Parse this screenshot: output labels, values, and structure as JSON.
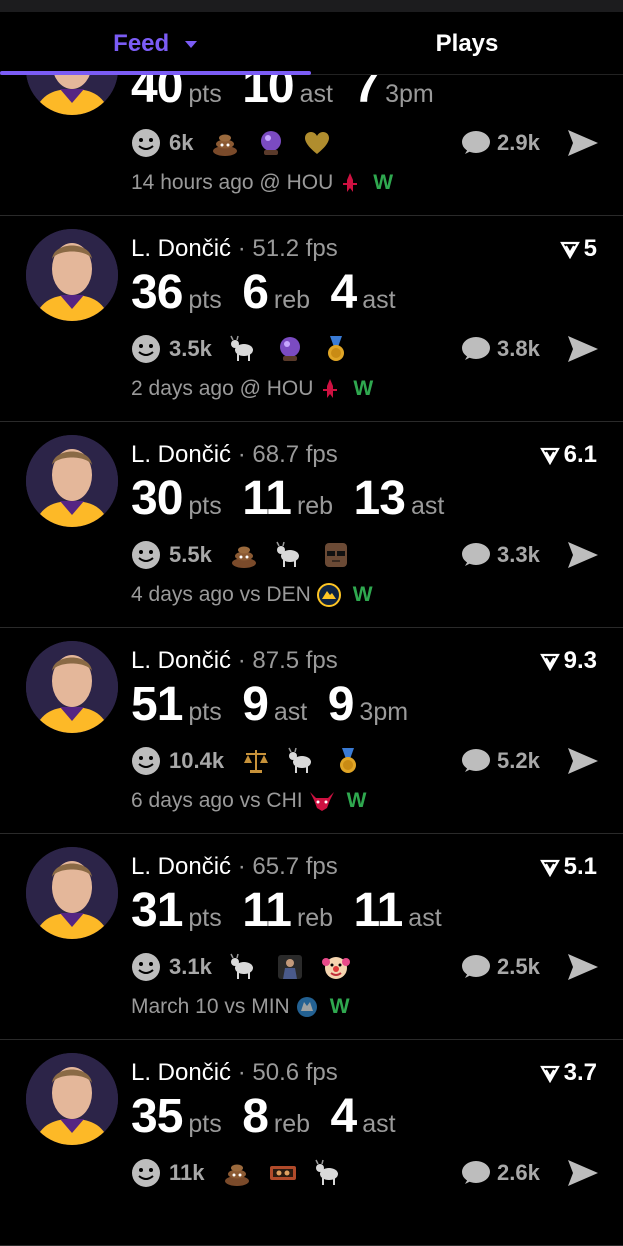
{
  "tabs": {
    "feed": "Feed",
    "plays": "Plays"
  },
  "cards": [
    {
      "player": "",
      "fps": "",
      "rank": "",
      "stats": [
        {
          "value": "40",
          "unit": "pts"
        },
        {
          "value": "10",
          "unit": "ast"
        },
        {
          "value": "7",
          "unit": "3pm"
        }
      ],
      "reaction_count": "6k",
      "emojis": [
        "poop-emoji",
        "crystal-ball-emoji",
        "gold-heart-emoji"
      ],
      "comment_count": "2.9k",
      "time": "14 hours ago @ HOU",
      "opponent_logo": "rockets-logo",
      "result": "W"
    },
    {
      "player": "L. Dončić",
      "fps": "· 51.2 fps",
      "rank": "5",
      "stats": [
        {
          "value": "36",
          "unit": "pts"
        },
        {
          "value": "6",
          "unit": "reb"
        },
        {
          "value": "4",
          "unit": "ast"
        }
      ],
      "reaction_count": "3.5k",
      "emojis": [
        "goat-emoji",
        "crystal-ball-emoji",
        "gold-medal-emoji"
      ],
      "comment_count": "3.8k",
      "time": "2 days ago @ HOU",
      "opponent_logo": "rockets-logo",
      "result": "W"
    },
    {
      "player": "L. Dončić",
      "fps": "· 68.7 fps",
      "rank": "6.1",
      "stats": [
        {
          "value": "30",
          "unit": "pts"
        },
        {
          "value": "11",
          "unit": "reb"
        },
        {
          "value": "13",
          "unit": "ast"
        }
      ],
      "reaction_count": "5.5k",
      "emojis": [
        "poop-emoji",
        "goat-emoji",
        "sunglasses-man-emoji"
      ],
      "comment_count": "3.3k",
      "time": "4 days ago vs DEN",
      "opponent_logo": "nuggets-logo",
      "result": "W"
    },
    {
      "player": "L. Dončić",
      "fps": "· 87.5 fps",
      "rank": "9.3",
      "stats": [
        {
          "value": "51",
          "unit": "pts"
        },
        {
          "value": "9",
          "unit": "ast"
        },
        {
          "value": "9",
          "unit": "3pm"
        }
      ],
      "reaction_count": "10.4k",
      "emojis": [
        "scales-emoji",
        "goat-emoji",
        "gold-medal-emoji"
      ],
      "comment_count": "5.2k",
      "time": "6 days ago vs CHI",
      "opponent_logo": "bulls-logo",
      "result": "W"
    },
    {
      "player": "L. Dončić",
      "fps": "· 65.7 fps",
      "rank": "5.1",
      "stats": [
        {
          "value": "31",
          "unit": "pts"
        },
        {
          "value": "11",
          "unit": "reb"
        },
        {
          "value": "11",
          "unit": "ast"
        }
      ],
      "reaction_count": "3.1k",
      "emojis": [
        "goat-emoji",
        "player-photo-emoji",
        "clown-emoji"
      ],
      "comment_count": "2.5k",
      "time": "March 10 vs MIN",
      "opponent_logo": "timberwolves-logo",
      "result": "W"
    },
    {
      "player": "L. Dončić",
      "fps": "· 50.6 fps",
      "rank": "3.7",
      "stats": [
        {
          "value": "35",
          "unit": "pts"
        },
        {
          "value": "8",
          "unit": "reb"
        },
        {
          "value": "4",
          "unit": "ast"
        }
      ],
      "reaction_count": "11k",
      "emojis": [
        "poop-emoji",
        "sticker-emoji",
        "goat-emoji"
      ],
      "comment_count": "2.6k",
      "time": "",
      "opponent_logo": "",
      "result": ""
    }
  ],
  "colors": {
    "accent": "#7b5cf5",
    "win": "#2fa84f",
    "muted": "#9a9a9a",
    "lakers_gold": "#fdb927"
  }
}
